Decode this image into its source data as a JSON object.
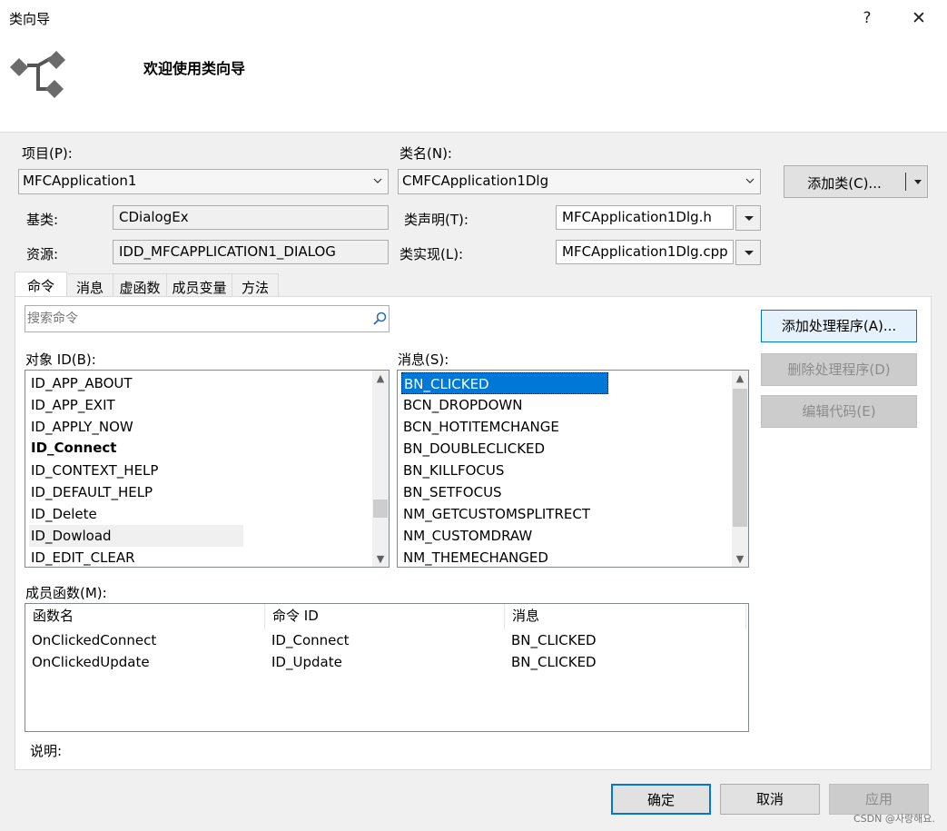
{
  "window": {
    "title": "类向导",
    "help": "?",
    "close": "✕"
  },
  "header": {
    "welcome": "欢迎使用类向导"
  },
  "form": {
    "project_label": "项目(P):",
    "project_value": "MFCApplication1",
    "classname_label": "类名(N):",
    "classname_value": "CMFCApplication1Dlg",
    "add_class_label": "添加类(C)...",
    "baseclass_label": "基类:",
    "baseclass_value": "CDialogEx",
    "classdecl_label": "类声明(T):",
    "classdecl_value": "MFCApplication1Dlg.h",
    "resource_label": "资源:",
    "resource_value": "IDD_MFCAPPLICATION1_DIALOG",
    "classimpl_label": "类实现(L):",
    "classimpl_value": "MFCApplication1Dlg.cpp"
  },
  "tabs": [
    "命令",
    "消息",
    "虚函数",
    "成员变量",
    "方法"
  ],
  "commands": {
    "search_placeholder": "搜索命令",
    "object_id_label": "对象 ID(B):",
    "messages_label": "消息(S):",
    "object_ids": [
      "ID_APP_ABOUT",
      "ID_APP_EXIT",
      "ID_APPLY_NOW",
      "ID_Connect",
      "ID_CONTEXT_HELP",
      "ID_DEFAULT_HELP",
      "ID_Delete",
      "ID_Dowload",
      "ID_EDIT_CLEAR"
    ],
    "messages": [
      "BN_CLICKED",
      "BCN_DROPDOWN",
      "BCN_HOTITEMCHANGE",
      "BN_DOUBLECLICKED",
      "BN_KILLFOCUS",
      "BN_SETFOCUS",
      "NM_GETCUSTOMSPLITRECT",
      "NM_CUSTOMDRAW",
      "NM_THEMECHANGED"
    ],
    "add_handler": "添加处理程序(A)...",
    "delete_handler": "删除处理程序(D)",
    "edit_code": "编辑代码(E)"
  },
  "members": {
    "label": "成员函数(M):",
    "columns": [
      "函数名",
      "命令 ID",
      "消息"
    ],
    "rows": [
      [
        "OnClickedConnect",
        "ID_Connect",
        "BN_CLICKED"
      ],
      [
        "OnClickedUpdate",
        "ID_Update",
        "BN_CLICKED"
      ]
    ],
    "description_label": "说明:"
  },
  "footer": {
    "ok": "确定",
    "cancel": "取消",
    "apply": "应用"
  },
  "watermark": "CSDN @사랑해요."
}
